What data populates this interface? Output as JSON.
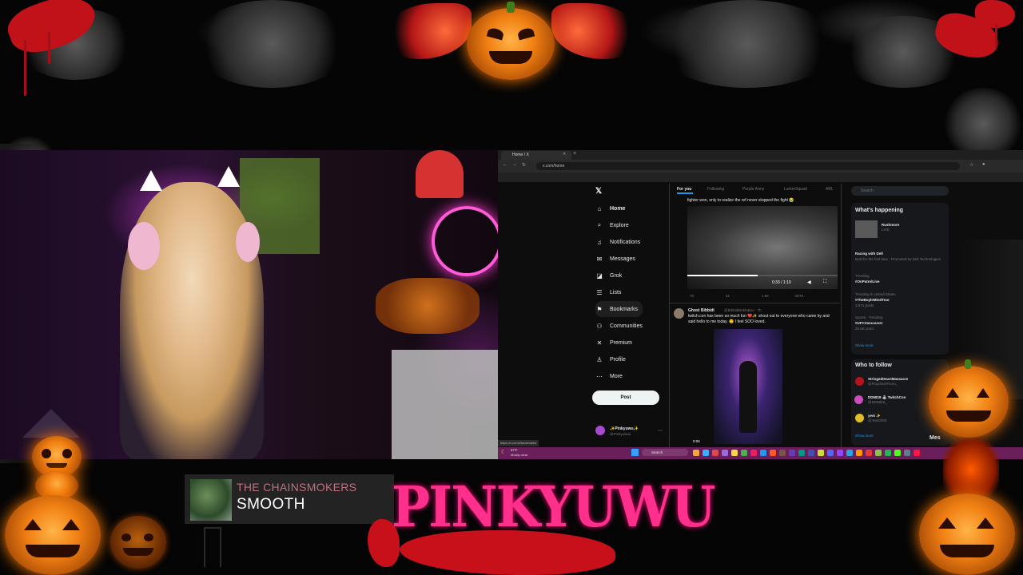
{
  "browser": {
    "tab_title": "Home / X",
    "url": "x.com/home",
    "status_url": "https://x.com/i/bookmarks"
  },
  "x_nav": {
    "items": [
      {
        "icon": "home-icon",
        "label": "Home"
      },
      {
        "icon": "search-icon",
        "label": "Explore"
      },
      {
        "icon": "bell-icon",
        "label": "Notifications"
      },
      {
        "icon": "mail-icon",
        "label": "Messages"
      },
      {
        "icon": "grok-icon",
        "label": "Grok"
      },
      {
        "icon": "list-icon",
        "label": "Lists"
      },
      {
        "icon": "bookmark-icon",
        "label": "Bookmarks"
      },
      {
        "icon": "people-icon",
        "label": "Communities"
      },
      {
        "icon": "x-icon",
        "label": "Premium"
      },
      {
        "icon": "person-icon",
        "label": "Profile"
      },
      {
        "icon": "more-icon",
        "label": "More"
      }
    ],
    "post_label": "Post",
    "account_name": "✨Pinkyuwu✨",
    "account_handle": "@Pinkyuwuu"
  },
  "feed": {
    "tabs": [
      "For you",
      "Following",
      "Purple Army",
      "LurkerSquad",
      "ARL"
    ],
    "tweet1_text": "fighter won, only to realize the ref never stopped the fight 😭",
    "video1_time": "0:33 / 1:10",
    "tweet1_stats": [
      "76",
      "41",
      "1.6K",
      "507K"
    ],
    "tweet2_author": "Ghost Bibbidi",
    "tweet2_handle": "@BibbidiBobbiBoo · 7h",
    "tweet2_text": "twitch.con has been so much fun ❤️✨ shout out to everyone who came by and said hello to me today. 😊 I feel SOO loved.",
    "video2_time": "0:06"
  },
  "sidebar": {
    "search_placeholder": "Search",
    "whats_happening": "What's happening",
    "trends": [
      {
        "cat": "",
        "name": "Rushmore",
        "sub": "LIVE"
      },
      {
        "cat": "",
        "name": "Racing with Dell",
        "sub": "Built for the fast lane · Promoted by Dell Technologies"
      },
      {
        "cat": "Trending",
        "name": "#OnPatrolLive",
        "sub": ""
      },
      {
        "cat": "Trending in United States",
        "name": "#TheBoyleMindTour",
        "sub": "3,971 posts"
      },
      {
        "cat": "Sports · Trending",
        "name": "#UFCVancouver",
        "sub": "25.5K posts"
      }
    ],
    "show_more": "Show more",
    "who_to_follow": "Who to follow",
    "follow": [
      {
        "name": "StringedHeartMassacre",
        "handle": "@FloydVonFionn_"
      },
      {
        "name": "DD5818 🕹 TwitchCon",
        "handle": "@DD5818_"
      },
      {
        "name": "yeet ✨",
        "handle": "@Yeet2000"
      }
    ],
    "show_more2": "Show more",
    "messages_label": "Mes"
  },
  "taskbar": {
    "weather_temp": "57°F",
    "weather_desc": "Mostly clear",
    "search_label": "Search"
  },
  "now_playing": {
    "artist": "THE CHAINSMOKERS",
    "title": "SMOOTH"
  },
  "brand_text": "PINKYUWU",
  "colors": {
    "brand_pink": "#ff2f8c",
    "blood_red": "#c8101a",
    "pumpkin_orange": "#f07f12",
    "taskbar_purple": "#6a1f5a"
  }
}
